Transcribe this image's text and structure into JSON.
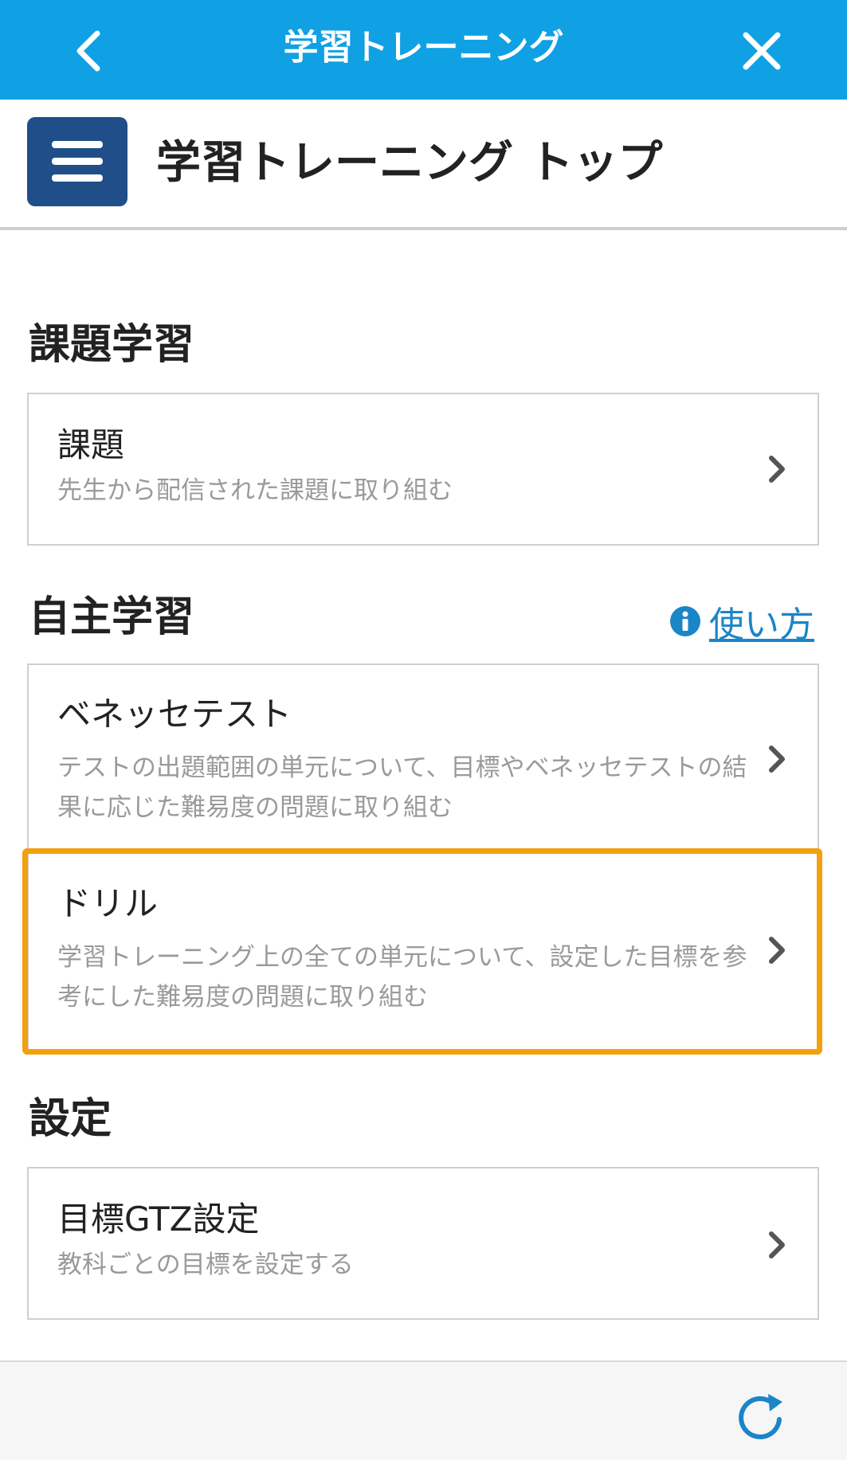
{
  "header": {
    "title": "学習トレーニング",
    "back_icon": "chevron-left-icon",
    "close_icon": "close-icon",
    "color": "#10a0e4"
  },
  "page": {
    "title": "学習トレーニング トップ",
    "menu_icon": "hamburger-menu-icon",
    "menu_color": "#1f4e88"
  },
  "sections": {
    "assignment": {
      "title": "課題学習",
      "card": {
        "title": "課題",
        "description": "先生から配信された課題に取り組む"
      }
    },
    "self_study": {
      "title": "自主学習",
      "help_label": "使い方",
      "cards": [
        {
          "title": "ベネッセテスト",
          "description": "テストの出題範囲の単元について、目標やベネッセテストの結果に応じた難易度の問題に取り組む"
        },
        {
          "title": "ドリル",
          "description": "学習トレーニング上の全ての単元について、設定した目標を参考にした難易度の問題に取り組む"
        }
      ]
    },
    "settings": {
      "title": "設定",
      "card": {
        "title": "目標GTZ設定",
        "description": "教科ごとの目標を設定する"
      }
    }
  },
  "highlight_color": "#f3a00f",
  "footer": {
    "refresh_icon": "refresh-icon"
  }
}
